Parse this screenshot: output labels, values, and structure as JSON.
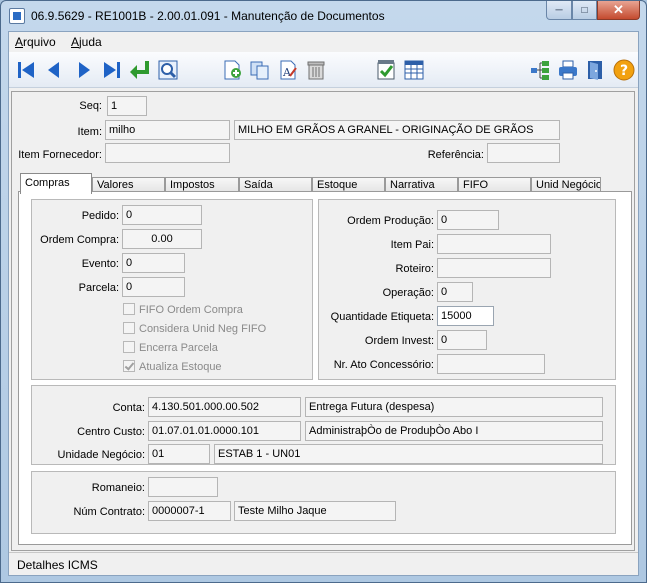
{
  "window": {
    "title": "06.9.5629 - RE1001B - 2.00.01.091 - Manutenção de Documentos"
  },
  "menu": {
    "file": {
      "accel": "A",
      "rest": "rquivo"
    },
    "help": {
      "accel": "A",
      "rest": "juda"
    }
  },
  "toolbar": {
    "icons": [
      "first-icon",
      "prev-icon",
      "next-icon",
      "last-icon",
      "return-icon",
      "zoom-icon",
      "new-icon",
      "copy-icon",
      "edit-icon",
      "delete-icon",
      "confirm-icon",
      "calendar-icon",
      "tree-icon",
      "print-icon",
      "exit-icon",
      "help-icon"
    ]
  },
  "header": {
    "seq_label": "Seq:",
    "seq_value": "1",
    "item_label": "Item:",
    "item_code": "milho",
    "item_desc": "MILHO EM GRÃOS A GRANEL - ORIGINAÇÃO DE GRÃOS",
    "supplier_item_label": "Item Fornecedor:",
    "supplier_item_value": "",
    "reference_label": "Referência:",
    "reference_value": ""
  },
  "tabs": [
    {
      "label": "Compras",
      "active": true
    },
    {
      "label": "Valores"
    },
    {
      "label": "Impostos"
    },
    {
      "label": "Saída"
    },
    {
      "label": "Estoque"
    },
    {
      "label": "Narrativa"
    },
    {
      "label": "FIFO"
    },
    {
      "label": "Unid Negócio"
    }
  ],
  "compras": {
    "pedido_label": "Pedido:",
    "pedido_value": "0",
    "ordem_compra_label": "Ordem Compra:",
    "ordem_compra_value": "0.00",
    "evento_label": "Evento:",
    "evento_value": "0",
    "parcela_label": "Parcela:",
    "parcela_value": "0",
    "checks": {
      "fifo": "FIFO Ordem Compra",
      "unid_neg": "Considera Unid Neg FIFO",
      "encerra": "Encerra Parcela",
      "atualiza": "Atualiza Estoque"
    },
    "ordem_producao_label": "Ordem Produção:",
    "ordem_producao_value": "0",
    "item_pai_label": "Item Pai:",
    "item_pai_value": "",
    "roteiro_label": "Roteiro:",
    "roteiro_value": "",
    "operacao_label": "Operação:",
    "operacao_value": "0",
    "qtd_etiqueta_label": "Quantidade Etiqueta:",
    "qtd_etiqueta_value": "15000",
    "ordem_invest_label": "Ordem Invest:",
    "ordem_invest_value": "0",
    "ato_label": "Nr. Ato Concessório:",
    "ato_value": "",
    "conta_label": "Conta:",
    "conta_value": "4.130.501.000.00.502",
    "conta_desc": "Entrega Futura (despesa)",
    "centro_label": "Centro Custo:",
    "centro_value": "01.07.01.01.0000.101",
    "centro_desc": "AdministraþÒo de ProduþÒo Abo I",
    "unidade_label": "Unidade Negócio:",
    "unidade_value": "01",
    "unidade_desc": "ESTAB 1 - UN01",
    "romaneio_label": "Romaneio:",
    "romaneio_value": "",
    "contrato_label": "Núm Contrato:",
    "contrato_value": "0000007-1",
    "contrato_desc": "Teste Milho Jaque"
  },
  "footer": {
    "label": "Detalhes ICMS"
  }
}
